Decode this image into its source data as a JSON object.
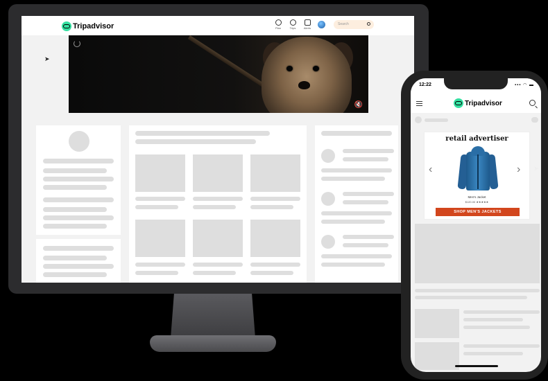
{
  "desktop": {
    "brand": {
      "name": "Tripadvisor"
    },
    "nav": [
      {
        "id": "plan",
        "label": "Plan",
        "icon": "plan-icon"
      },
      {
        "id": "trips",
        "label": "Trips",
        "icon": "heart-icon"
      },
      {
        "id": "alerts",
        "label": "Alerts",
        "icon": "bell-icon"
      }
    ],
    "search": {
      "placeholder": "Search"
    },
    "video": {
      "mute_icon": "speaker-muted-icon"
    }
  },
  "phone": {
    "status": {
      "time": "12:22",
      "icons": "▪▪▪ ◠ ▬"
    },
    "brand": {
      "name": "Tripadvisor"
    },
    "ad": {
      "title": "retail advertiser",
      "product_name": "Men's Jacket",
      "product_price": "$120.00 ★★★★★",
      "cta": "SHOP MEN'S JACKETS",
      "prev": "‹",
      "next": "›"
    }
  },
  "colors": {
    "brand_green": "#34e0a1",
    "cta_orange": "#d2461d",
    "placeholder_gray": "#dedede",
    "page_bg": "#f2f2f2"
  }
}
